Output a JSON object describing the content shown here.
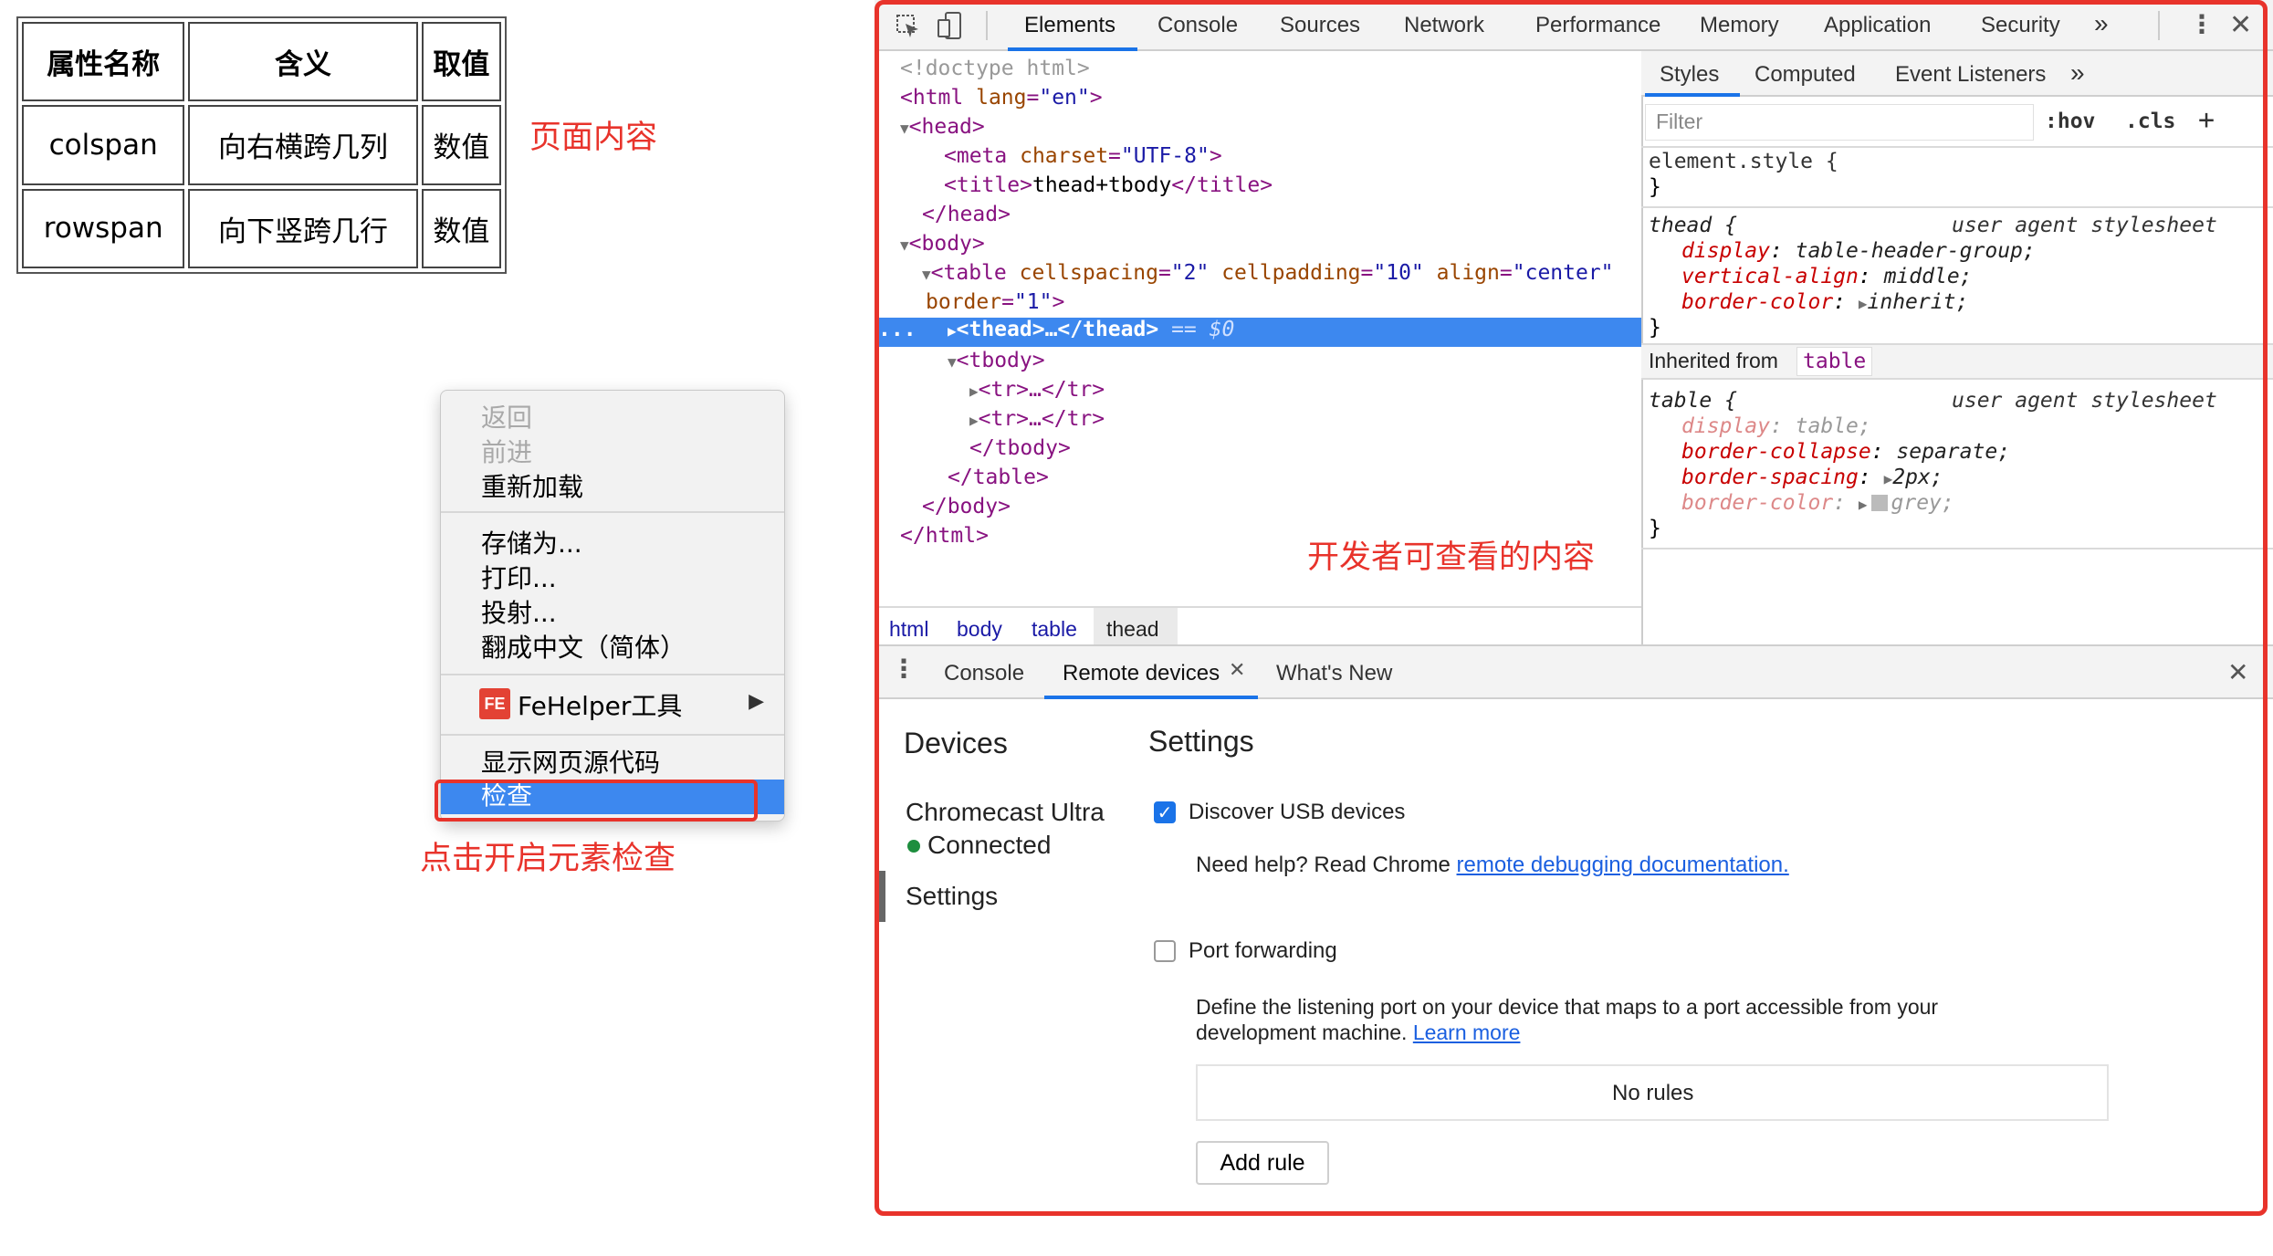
{
  "demo_table": {
    "headers": [
      "属性名称",
      "含义",
      "取值"
    ],
    "rows": [
      [
        "colspan",
        "向右横跨几列",
        "数值"
      ],
      [
        "rowspan",
        "向下竖跨几行",
        "数值"
      ]
    ]
  },
  "annotations": {
    "page_content": "页面内容",
    "devtools_content": "开发者可查看的内容",
    "inspect_hint": "点击开启元素检查"
  },
  "context_menu": {
    "back": "返回",
    "forward": "前进",
    "reload": "重新加载",
    "save_as": "存储为...",
    "print": "打印...",
    "cast": "投射...",
    "translate": "翻成中文（简体）",
    "fehelper": "FeHelper工具",
    "view_source": "显示网页源代码",
    "inspect": "检查"
  },
  "devtools": {
    "tabs": [
      "Elements",
      "Console",
      "Sources",
      "Network",
      "Performance",
      "Memory",
      "Application",
      "Security"
    ],
    "more": "»",
    "dom": {
      "doctype": "<!doctype html>",
      "html_tag": "html",
      "lang_attr": "lang",
      "lang_val": "\"en\"",
      "head": "head",
      "meta": "meta",
      "charset_attr": "charset",
      "charset_val": "\"UTF-8\"",
      "title_tag": "title",
      "title_text": "thead+tbody",
      "body": "body",
      "table": "table",
      "cellspacing_attr": "cellspacing",
      "cellspacing_val": "\"2\"",
      "cellpadding_attr": "cellpadding",
      "cellpadding_val": "\"10\"",
      "align_attr": "align",
      "align_val": "\"center\"",
      "border_attr": "border",
      "border_val": "\"1\"",
      "thead_collapsed": "<thead>…</thead>",
      "selected_marker": "== $0",
      "ellipsis": "...",
      "tbody": "tbody",
      "tr_collapsed": "<tr>…</tr>"
    },
    "styles_tabs": [
      "Styles",
      "Computed",
      "Event Listeners"
    ],
    "filter_placeholder": "Filter",
    "hov": ":hov",
    "cls": ".cls",
    "plus": "+",
    "rules": {
      "element_style": "element.style {",
      "close_brace": "}",
      "thead_selector": "thead {",
      "ua": "user agent stylesheet",
      "thead_props": [
        {
          "prop": "display",
          "value": "table-header-group;"
        },
        {
          "prop": "vertical-align",
          "value": "middle;"
        },
        {
          "prop": "border-color",
          "value": "inherit;"
        }
      ],
      "inherited_from": "Inherited from",
      "inherited_tag": "table",
      "table_selector": "table {",
      "table_props": [
        {
          "prop": "display",
          "value": "table;"
        },
        {
          "prop": "border-collapse",
          "value": "separate;"
        },
        {
          "prop": "border-spacing",
          "value": "2px;"
        },
        {
          "prop": "border-color",
          "value": "grey;"
        }
      ]
    },
    "breadcrumbs": [
      "html",
      "body",
      "table",
      "thead"
    ],
    "drawer_tabs": [
      "Console",
      "Remote devices",
      "What's New"
    ],
    "remote": {
      "devices_title": "Devices",
      "settings_title": "Settings",
      "device_name": "Chromecast Ultra",
      "device_status": "Connected",
      "settings_nav": "Settings",
      "discover_usb": "Discover USB devices",
      "help_text": "Need help? Read Chrome",
      "help_link": "remote debugging documentation.",
      "port_forwarding": "Port forwarding",
      "port_desc_1": "Define the listening port on your device that maps to a port accessible from your",
      "port_desc_2": "development machine.",
      "learn_more": "Learn more",
      "no_rules": "No rules",
      "add_rule": "Add rule"
    },
    "colors": {
      "accent": "#1a73e8",
      "selection": "#3d88ef",
      "annotation": "#e8332b",
      "status_green": "#1e8e3e"
    }
  }
}
